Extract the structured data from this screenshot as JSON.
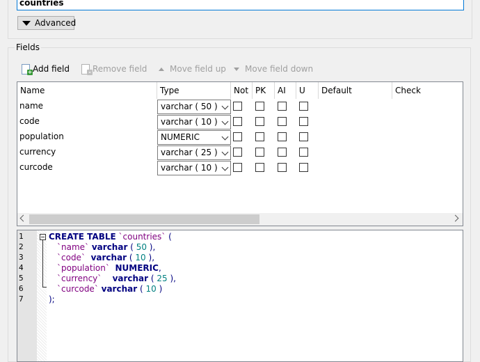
{
  "table_name": {
    "value": "countries"
  },
  "advanced": {
    "label": "Advanced"
  },
  "fields": {
    "title": "Fields",
    "toolbar": {
      "add_field": "Add field",
      "remove_field": "Remove field",
      "move_up": "Move field up",
      "move_down": "Move field down"
    },
    "columns": [
      "Name",
      "Type",
      "Not",
      "PK",
      "AI",
      "U",
      "Default",
      "Check"
    ],
    "rows": [
      {
        "name": "name",
        "type": "varchar ( 50 )"
      },
      {
        "name": "code",
        "type": "varchar ( 10 )"
      },
      {
        "name": "population",
        "type": "NUMERIC"
      },
      {
        "name": "currency",
        "type": "varchar ( 25 )"
      },
      {
        "name": "curcode",
        "type": "varchar ( 10 )"
      }
    ]
  },
  "sql": {
    "line_numbers": [
      "1",
      "2",
      "3",
      "4",
      "5",
      "6",
      "7"
    ],
    "l1": {
      "kw": "CREATE TABLE",
      "ident": "`countries`",
      "p": " ("
    },
    "l2": {
      "ident": "`name`",
      "kw": "varchar",
      "p1": " ( ",
      "num": "50",
      "p2": " ),"
    },
    "l3": {
      "ident": "`code`",
      "kw": "varchar",
      "p1": " ( ",
      "num": "10",
      "p2": " ),"
    },
    "l4": {
      "ident": "`population`",
      "kw": "NUMERIC",
      "p": ","
    },
    "l5": {
      "ident": "`currency`",
      "kw": "varchar",
      "p1": " ( ",
      "num": "25",
      "p2": " ),"
    },
    "l6": {
      "ident": "`curcode`",
      "kw": "varchar",
      "p1": " ( ",
      "num": "10",
      "p2": " )"
    },
    "l7": {
      "p": ");"
    }
  }
}
